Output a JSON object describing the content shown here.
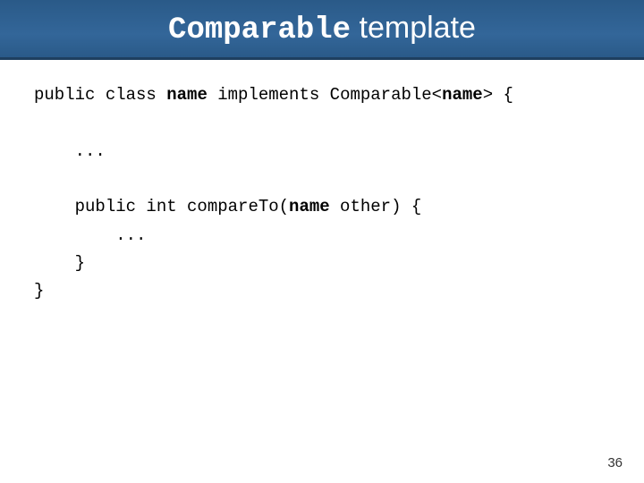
{
  "title": {
    "mono_part": "Comparable",
    "sans_part": " template"
  },
  "code": {
    "l1_a": "public class ",
    "l1_b": "name",
    "l1_c": " implements Comparable<",
    "l1_d": "name",
    "l1_e": "> {",
    "blank1": "",
    "l2": "    ...",
    "blank2": "",
    "l3_a": "    public int compareTo(",
    "l3_b": "name",
    "l3_c": " other) {",
    "l4": "        ...",
    "l5": "    }",
    "l6": "}"
  },
  "page_number": "36"
}
